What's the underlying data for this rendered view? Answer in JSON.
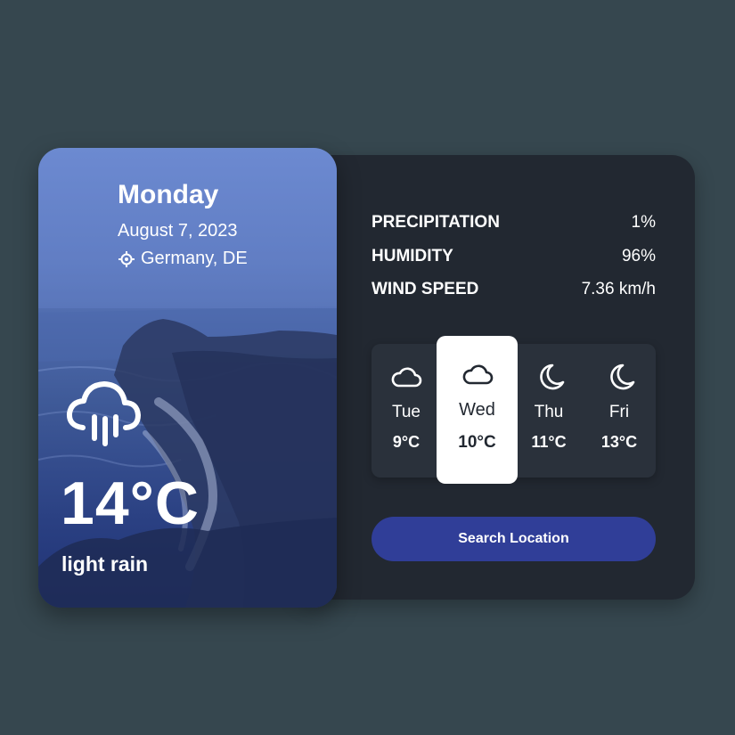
{
  "hero": {
    "day": "Monday",
    "date": "August 7, 2023",
    "location": "Germany, DE",
    "temperature": "14°C",
    "condition": "light rain",
    "weather_icon": "cloud-rain-icon",
    "location_icon": "crosshair-icon"
  },
  "stats": [
    {
      "label": "PRECIPITATION",
      "value": "1%"
    },
    {
      "label": "HUMIDITY",
      "value": "96%"
    },
    {
      "label": "WIND SPEED",
      "value": "7.36 km/h"
    }
  ],
  "forecast": [
    {
      "day": "Tue",
      "temp": "9°C",
      "icon": "cloud-icon"
    },
    {
      "day": "Wed",
      "temp": "10°C",
      "icon": "cloud-icon",
      "active": true
    },
    {
      "day": "Thu",
      "temp": "11°C",
      "icon": "moon-icon"
    },
    {
      "day": "Fri",
      "temp": "13°C",
      "icon": "moon-icon"
    }
  ],
  "search_button": {
    "label": "Search Location"
  },
  "colors": {
    "page_background": "#36474f",
    "panel_background": "#222831",
    "forecast_strip": "#2a313b",
    "accent_button": "#303e98",
    "card_gradient_top": "#6a88cf",
    "card_gradient_bottom": "#1f3174"
  }
}
